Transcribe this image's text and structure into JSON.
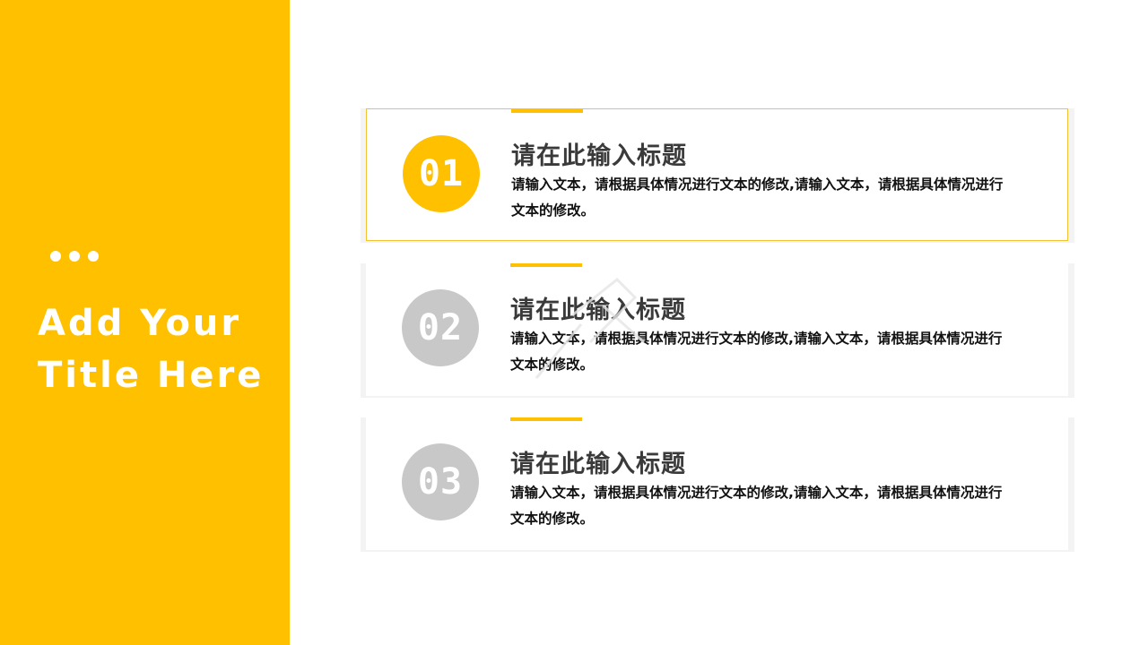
{
  "sidebar": {
    "title_line1": "Add Your",
    "title_line2": "Title Here",
    "background_color": "#FFC000"
  },
  "cards": [
    {
      "number": "01",
      "title": "请在此输入标题",
      "body": "请输入文本，请根据具体情况进行文本的修改,请输入文本，请根据具体情况进行文本的修改。",
      "circle_color": "#FFC000",
      "highlighted": true
    },
    {
      "number": "02",
      "title": "请在此输入标题",
      "body": "请输入文本，请根据具体情况进行文本的修改,请输入文本，请根据具体情况进行文本的修改。",
      "circle_color": "#C8C8C8",
      "highlighted": false
    },
    {
      "number": "03",
      "title": "请在此输入标题",
      "body": "请输入文本，请根据具体情况进行文本的修改,请输入文本，请根据具体情况进行文本的修改。",
      "circle_color": "#C8C8C8",
      "highlighted": false
    }
  ],
  "colors": {
    "accent": "#FFC000",
    "inactive": "#C8C8C8",
    "title_text": "#3A3A3A"
  }
}
